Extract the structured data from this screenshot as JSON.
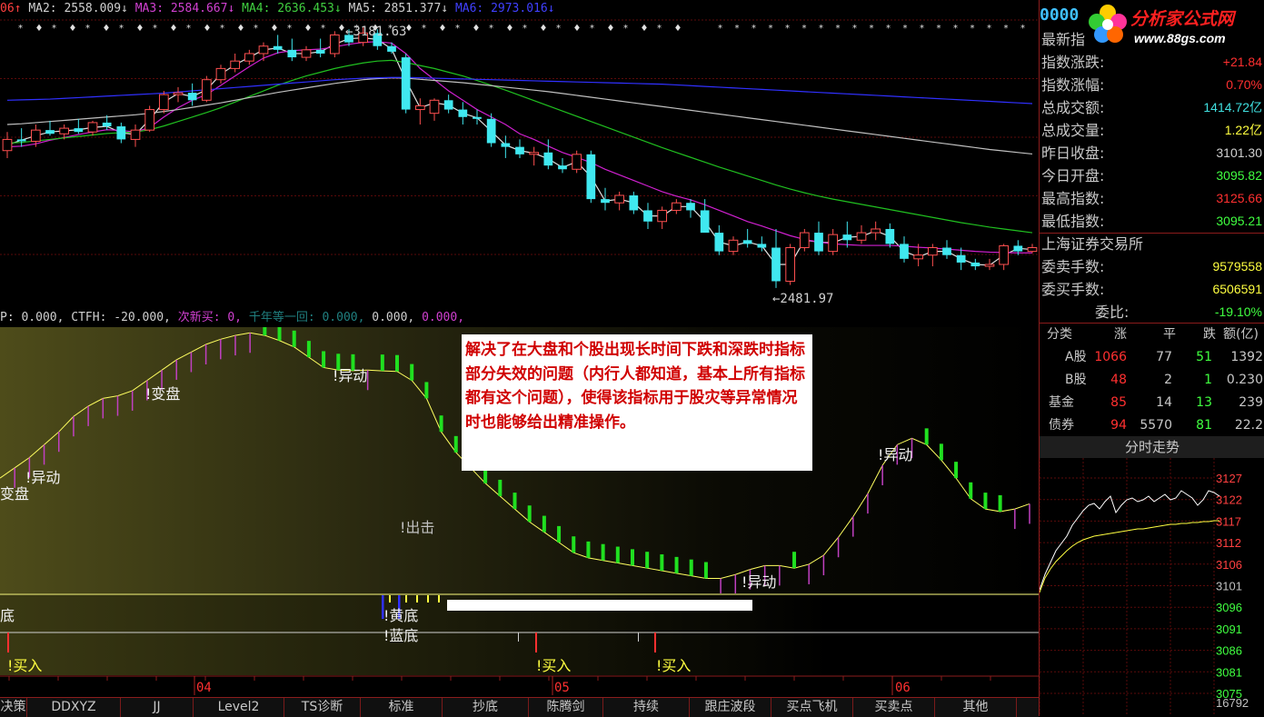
{
  "ma_legend": {
    "prefix": "06↑",
    "items": [
      {
        "text": "MA2: 2558.009↓",
        "color": "#d0d0d0"
      },
      {
        "text": "MA3: 2584.667↓",
        "color": "#d040d0"
      },
      {
        "text": "MA4: 2636.453↓",
        "color": "#40d040"
      },
      {
        "text": "MA5: 2851.377↓",
        "color": "#d0d0d0"
      },
      {
        "text": "MA6: 2973.016↓",
        "color": "#4040ff"
      }
    ]
  },
  "price_labels": {
    "high": "←3181.63",
    "low": "←2481.97"
  },
  "indicator_header": [
    {
      "text": "P: 0.000,",
      "color": "#d0d0d0"
    },
    {
      "text": "CTFH: -20.000,",
      "color": "#d0d0d0"
    },
    {
      "text": "次新买: 0,",
      "color": "#d040d0"
    },
    {
      "text": "千年等一回: 0.000,",
      "color": "#208080"
    },
    {
      "text": "0.000,",
      "color": "#d0d0d0"
    },
    {
      "text": "0.000,",
      "color": "#d040d0"
    }
  ],
  "note_text": "解决了在大盘和个股出现长时间下跌和深跌时指标部分失效的问题（内行人都知道，基本上所有指标都有这个问题），使得该指标用于股灾等异常情况时也能够给出精准操作。",
  "signals": {
    "bianpan1": "!变盘",
    "bianpan2": "变盘",
    "yidong1": "!异动",
    "yidong2": "!异动",
    "yidong3": "!异动",
    "yidong4": "!异动",
    "chuji": "!出击",
    "di": "底",
    "huangdi": "!黄底",
    "landi": "!蓝底",
    "mairu1": "!买入",
    "mairu2": "!买入",
    "mairu3": "!买入"
  },
  "date_axis": {
    "labels": [
      "04",
      "05",
      "06"
    ]
  },
  "tabs": [
    "决策",
    "DDXYZ",
    "JJ",
    "Level2",
    "TS诊断",
    "标准",
    "抄底",
    "陈腾剑",
    "持续",
    "跟庄波段",
    "买点飞机",
    "买卖点",
    "其他"
  ],
  "logo": {
    "code": "0000",
    "title": "分析家公式网",
    "url": "www.88gs.com"
  },
  "quote": {
    "rows": [
      {
        "label": "最新指",
        "value": "",
        "color": "#ff3030"
      },
      {
        "label": "指数涨跌:",
        "value": "+21.84",
        "color": "#ff3030"
      },
      {
        "label": "指数涨幅:",
        "value": "0.70%",
        "color": "#ff3030"
      },
      {
        "label": "总成交额:",
        "value": "1414.72亿",
        "color": "#40e0e0"
      },
      {
        "label": "总成交量:",
        "value": "1.22亿",
        "color": "#ffff40"
      },
      {
        "label": "昨日收盘:",
        "value": "3101.30",
        "color": "#d0d0d0"
      },
      {
        "label": "今日开盘:",
        "value": "3095.82",
        "color": "#40ff40"
      },
      {
        "label": "最高指数:",
        "value": "3125.66",
        "color": "#ff3030"
      },
      {
        "label": "最低指数:",
        "value": "3095.21",
        "color": "#40ff40"
      }
    ],
    "exchange": "上海证券交易所",
    "orders": [
      {
        "label": "委卖手数:",
        "value": "9579558",
        "color": "#ffff40"
      },
      {
        "label": "委买手数:",
        "value": "6506591",
        "color": "#ffff40"
      },
      {
        "label": "委比:",
        "value": "-19.10%",
        "color": "#40ff40"
      }
    ]
  },
  "breadth": {
    "headers": [
      "分类",
      "涨",
      "平",
      "跌",
      "额(亿)"
    ],
    "rows": [
      {
        "name": "A股",
        "up": "1066",
        "flat": "77",
        "down": "51",
        "amount": "1392"
      },
      {
        "name": "B股",
        "up": "48",
        "flat": "2",
        "down": "1",
        "amount": "0.230"
      },
      {
        "name": "基金",
        "up": "85",
        "flat": "14",
        "down": "13",
        "amount": "239"
      },
      {
        "name": "债券",
        "up": "94",
        "flat": "5570",
        "down": "81",
        "amount": "22.2"
      }
    ]
  },
  "minute_title": "分时走势",
  "minute_axis": {
    "ticks": [
      "3127",
      "3122",
      "3117",
      "3112",
      "3106",
      "3101",
      "3096",
      "3091",
      "3086",
      "3081",
      "3075"
    ],
    "volume": "16792"
  },
  "chart_data": {
    "type": "candlestick",
    "title": "",
    "x_labels": [
      "04",
      "05",
      "06"
    ],
    "price_range": [
      2481.97,
      3181.63
    ],
    "annotations": {
      "high": 3181.63,
      "low": 2481.97
    },
    "candles_ohlc": [
      [
        2850,
        2900,
        2830,
        2880
      ],
      [
        2880,
        2910,
        2860,
        2875
      ],
      [
        2875,
        2920,
        2860,
        2905
      ],
      [
        2905,
        2930,
        2890,
        2895
      ],
      [
        2895,
        2920,
        2880,
        2910
      ],
      [
        2910,
        2935,
        2895,
        2900
      ],
      [
        2900,
        2930,
        2890,
        2925
      ],
      [
        2925,
        2945,
        2905,
        2915
      ],
      [
        2915,
        2925,
        2870,
        2880
      ],
      [
        2880,
        2920,
        2860,
        2905
      ],
      [
        2905,
        2970,
        2900,
        2960
      ],
      [
        2960,
        3010,
        2950,
        3000
      ],
      [
        3000,
        3020,
        2980,
        3005
      ],
      [
        3005,
        3030,
        2970,
        2985
      ],
      [
        2985,
        3050,
        2980,
        3040
      ],
      [
        3040,
        3080,
        3030,
        3070
      ],
      [
        3070,
        3110,
        3060,
        3090
      ],
      [
        3090,
        3120,
        3080,
        3110
      ],
      [
        3110,
        3140,
        3090,
        3130
      ],
      [
        3130,
        3160,
        3110,
        3120
      ],
      [
        3120,
        3150,
        3090,
        3100
      ],
      [
        3100,
        3130,
        3090,
        3120
      ],
      [
        3120,
        3150,
        3100,
        3110
      ],
      [
        3110,
        3170,
        3100,
        3160
      ],
      [
        3160,
        3175,
        3130,
        3140
      ],
      [
        3140,
        3181.63,
        3130,
        3165
      ],
      [
        3165,
        3175,
        3120,
        3130
      ],
      [
        3130,
        3140,
        3110,
        3115
      ],
      [
        3100,
        3110,
        2950,
        2960
      ],
      [
        2960,
        2990,
        2920,
        2970
      ],
      [
        2950,
        2990,
        2930,
        2985
      ],
      [
        2985,
        3000,
        2950,
        2960
      ],
      [
        2960,
        2980,
        2920,
        2940
      ],
      [
        2940,
        2960,
        2920,
        2935
      ],
      [
        2935,
        2950,
        2860,
        2870
      ],
      [
        2870,
        2890,
        2830,
        2860
      ],
      [
        2860,
        2880,
        2830,
        2840
      ],
      [
        2840,
        2860,
        2810,
        2845
      ],
      [
        2845,
        2880,
        2800,
        2810
      ],
      [
        2810,
        2830,
        2790,
        2800
      ],
      [
        2800,
        2850,
        2790,
        2840
      ],
      [
        2840,
        2850,
        2710,
        2720
      ],
      [
        2720,
        2750,
        2690,
        2710
      ],
      [
        2710,
        2740,
        2690,
        2730
      ],
      [
        2730,
        2740,
        2680,
        2690
      ],
      [
        2690,
        2710,
        2640,
        2660
      ],
      [
        2660,
        2700,
        2640,
        2690
      ],
      [
        2690,
        2720,
        2680,
        2710
      ],
      [
        2710,
        2720,
        2670,
        2690
      ],
      [
        2690,
        2720,
        2650,
        2630
      ],
      [
        2630,
        2650,
        2570,
        2580
      ],
      [
        2580,
        2620,
        2570,
        2610
      ],
      [
        2610,
        2640,
        2590,
        2600
      ],
      [
        2600,
        2620,
        2580,
        2590
      ],
      [
        2590,
        2640,
        2482,
        2500
      ],
      [
        2500,
        2600,
        2490,
        2590
      ],
      [
        2590,
        2640,
        2580,
        2630
      ],
      [
        2630,
        2660,
        2570,
        2580
      ],
      [
        2580,
        2640,
        2570,
        2625
      ],
      [
        2625,
        2660,
        2590,
        2610
      ],
      [
        2610,
        2650,
        2600,
        2630
      ],
      [
        2630,
        2660,
        2610,
        2640
      ],
      [
        2640,
        2655,
        2590,
        2600
      ],
      [
        2600,
        2620,
        2550,
        2560
      ],
      [
        2560,
        2600,
        2540,
        2570
      ],
      [
        2570,
        2600,
        2540,
        2590
      ],
      [
        2590,
        2610,
        2560,
        2570
      ],
      [
        2570,
        2590,
        2530,
        2550
      ],
      [
        2550,
        2560,
        2530,
        2540
      ],
      [
        2540,
        2560,
        2530,
        2545
      ],
      [
        2545,
        2600,
        2530,
        2595
      ],
      [
        2595,
        2610,
        2570,
        2580
      ],
      [
        2580,
        2600,
        2575,
        2590
      ]
    ],
    "ma_lines": [
      {
        "name": "MA2",
        "values": [
          2865,
          2878,
          2890,
          2900,
          2903,
          2906,
          2912,
          2915,
          2898,
          2893,
          2933,
          2980,
          3003,
          2995,
          3013,
          3055,
          3080,
          3100,
          3120,
          3125,
          3110,
          3110,
          3115,
          3135,
          3150,
          3152,
          3148,
          3122,
          3038,
          2965,
          2978,
          2972,
          2950,
          2938,
          2902,
          2865,
          2850,
          2843,
          2828,
          2805,
          2820,
          2780,
          2715,
          2720,
          2710,
          2675,
          2675,
          2700,
          2700,
          2660,
          2605,
          2595,
          2605,
          2595,
          2545,
          2545,
          2610,
          2605,
          2603,
          2618,
          2620,
          2635,
          2620,
          2580,
          2565,
          2580,
          2580,
          2560,
          2545,
          2543,
          2570,
          2588,
          2585
        ]
      },
      {
        "name": "MA3",
        "values": [
          2860,
          2862,
          2868,
          2878,
          2885,
          2893,
          2900,
          2906,
          2904,
          2900,
          2912,
          2940,
          2965,
          2985,
          3000,
          3025,
          3050,
          3075,
          3098,
          3112,
          3118,
          3120,
          3122,
          3128,
          3135,
          3140,
          3142,
          3138,
          3110,
          3070,
          3040,
          3010,
          2985,
          2960,
          2940,
          2920,
          2895,
          2880,
          2862,
          2845,
          2832,
          2818,
          2800,
          2785,
          2770,
          2755,
          2740,
          2728,
          2718,
          2705,
          2690,
          2675,
          2660,
          2648,
          2635,
          2622,
          2612,
          2605,
          2600,
          2598,
          2596,
          2596,
          2596,
          2594,
          2591,
          2589,
          2586,
          2583,
          2580,
          2578,
          2577,
          2576,
          2576
        ]
      },
      {
        "name": "MA4",
        "values": [
          2870,
          2872,
          2876,
          2880,
          2884,
          2888,
          2892,
          2896,
          2898,
          2900,
          2906,
          2916,
          2928,
          2940,
          2952,
          2965,
          2980,
          2995,
          3010,
          3025,
          3038,
          3050,
          3060,
          3070,
          3078,
          3085,
          3090,
          3092,
          3086,
          3078,
          3070,
          3060,
          3050,
          3038,
          3025,
          3012,
          2998,
          2984,
          2970,
          2956,
          2942,
          2928,
          2914,
          2900,
          2886,
          2872,
          2858,
          2845,
          2832,
          2819,
          2806,
          2794,
          2782,
          2770,
          2758,
          2747,
          2737,
          2728,
          2720,
          2713,
          2706,
          2699,
          2692,
          2685,
          2678,
          2671,
          2664,
          2657,
          2651,
          2645,
          2640,
          2635,
          2630
        ]
      },
      {
        "name": "MA5",
        "values": [
          2920,
          2922,
          2925,
          2928,
          2931,
          2934,
          2937,
          2940,
          2943,
          2946,
          2950,
          2955,
          2960,
          2966,
          2972,
          2978,
          2985,
          2992,
          2999,
          3006,
          3012,
          3018,
          3024,
          3030,
          3035,
          3040,
          3043,
          3045,
          3044,
          3041,
          3038,
          3035,
          3032,
          3028,
          3024,
          3020,
          3016,
          3012,
          3008,
          3003,
          2998,
          2993,
          2988,
          2983,
          2978,
          2973,
          2968,
          2963,
          2958,
          2953,
          2948,
          2943,
          2938,
          2933,
          2928,
          2923,
          2918,
          2913,
          2908,
          2903,
          2898,
          2893,
          2888,
          2883,
          2878,
          2873,
          2868,
          2863,
          2858,
          2853,
          2849,
          2845,
          2841
        ]
      },
      {
        "name": "MA6",
        "values": [
          2985,
          2986,
          2987,
          2988,
          2990,
          2992,
          2994,
          2996,
          2998,
          3000,
          3002,
          3004,
          3007,
          3010,
          3013,
          3016,
          3019,
          3022,
          3025,
          3028,
          3031,
          3034,
          3037,
          3040,
          3042,
          3044,
          3045,
          3046,
          3046,
          3045,
          3044,
          3043,
          3042,
          3041,
          3040,
          3039,
          3038,
          3037,
          3036,
          3035,
          3034,
          3033,
          3032,
          3031,
          3030,
          3029,
          3028,
          3026,
          3024,
          3022,
          3020,
          3018,
          3016,
          3014,
          3012,
          3010,
          3008,
          3006,
          3004,
          3002,
          3000,
          2998,
          2996,
          2994,
          2992,
          2990,
          2988,
          2986,
          2984,
          2982,
          2980,
          2978,
          2976
        ]
      }
    ],
    "indicator_line": [
      0.42,
      0.46,
      0.5,
      0.55,
      0.6,
      0.66,
      0.7,
      0.73,
      0.74,
      0.76,
      0.8,
      0.84,
      0.88,
      0.91,
      0.94,
      0.96,
      0.975,
      0.985,
      0.975,
      0.955,
      0.93,
      0.89,
      0.85,
      0.84,
      0.838,
      0.84,
      0.837,
      0.835,
      0.8,
      0.73,
      0.6,
      0.52,
      0.46,
      0.4,
      0.35,
      0.3,
      0.25,
      0.21,
      0.17,
      0.13,
      0.11,
      0.1,
      0.09,
      0.08,
      0.07,
      0.06,
      0.05,
      0.04,
      0.03,
      0.03,
      0.045,
      0.065,
      0.08,
      0.08,
      0.07,
      0.085,
      0.12,
      0.19,
      0.27,
      0.36,
      0.47,
      0.55,
      0.575,
      0.55,
      0.49,
      0.42,
      0.34,
      0.3,
      0.29,
      0.3,
      0.32
    ]
  }
}
